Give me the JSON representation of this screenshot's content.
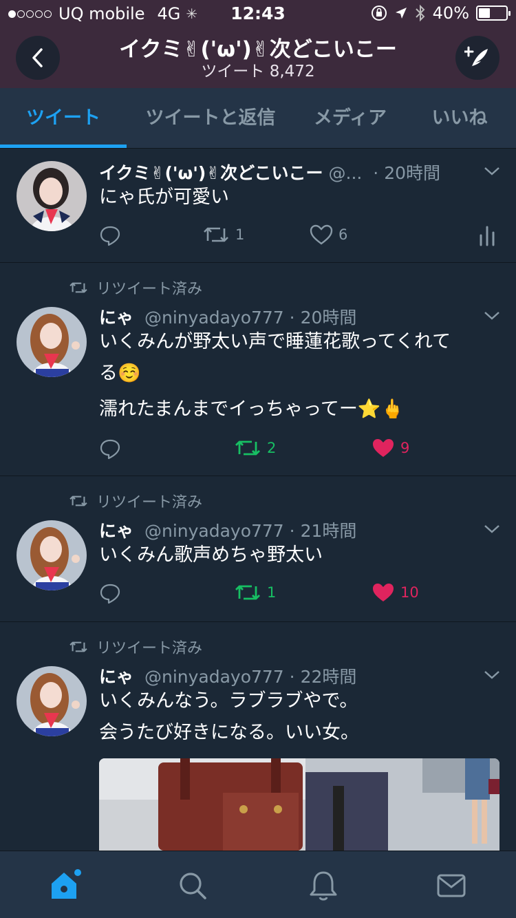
{
  "status": {
    "carrier": "UQ mobile",
    "network": "4G",
    "time": "12:43",
    "battery": "40%",
    "battery_level": 0.4
  },
  "header": {
    "title": "イクミ✌('ω')✌次どこいこー",
    "subtitle": "ツイート 8,472"
  },
  "tabs": [
    "ツイート",
    "ツイートと返信",
    "メディア",
    "いいね"
  ],
  "tweets": [
    {
      "retweet_label": "",
      "name": "イクミ✌('ω')✌次どこいこー",
      "handle": "@...",
      "time": "· 20時間",
      "lines": [
        "にゃ氏が可愛い"
      ],
      "retweets": "1",
      "likes": "6"
    },
    {
      "retweet_label": "リツイート済み",
      "name": "にゃ",
      "handle": "@ninyadayo777",
      "time": "· 20時間",
      "lines": [
        "いくみんが野太い声で睡蓮花歌ってくれて",
        "る☺️",
        "濡れたまんまでイっちゃってー⭐️🖕"
      ],
      "retweets": "2",
      "likes": "9"
    },
    {
      "retweet_label": "リツイート済み",
      "name": "にゃ",
      "handle": "@ninyadayo777",
      "time": "· 21時間",
      "lines": [
        "いくみん歌声めちゃ野太い"
      ],
      "retweets": "1",
      "likes": "10"
    },
    {
      "retweet_label": "リツイート済み",
      "name": "にゃ",
      "handle": "@ninyadayo777",
      "time": "· 22時間",
      "lines": [
        "いくみんなう。ラブラブやで。",
        "会うたび好きになる。いい女。"
      ],
      "retweets": "",
      "likes": ""
    }
  ],
  "colors": {
    "accent": "#1da1f2",
    "retweet_active": "#17bf63",
    "like_active": "#e0245e",
    "background": "#1b2836",
    "header": "#3c2a3c"
  },
  "nav_icons": [
    "home-icon",
    "search-icon",
    "notifications-icon",
    "messages-icon"
  ]
}
